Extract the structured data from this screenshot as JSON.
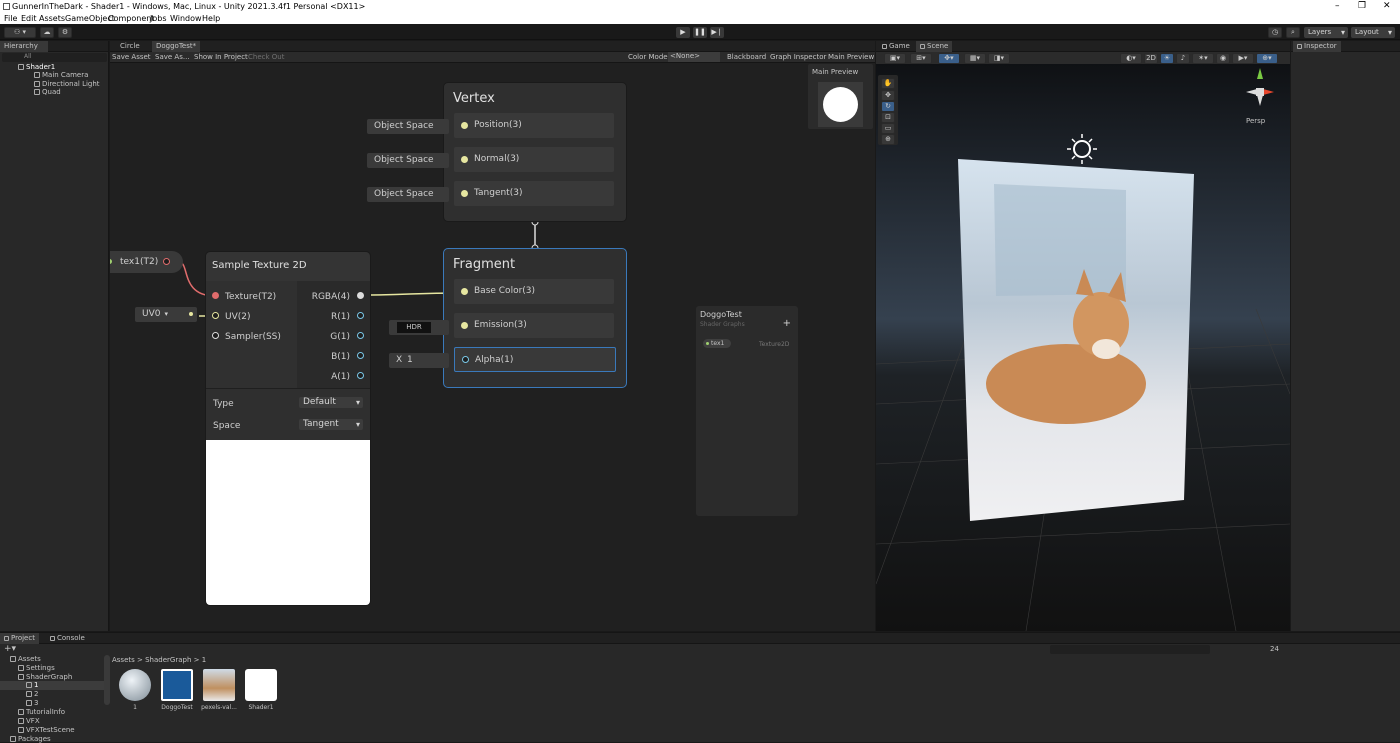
{
  "window": {
    "title": "GunnerInTheDark - Shader1 - Windows, Mac, Linux - Unity 2021.3.4f1 Personal <DX11>"
  },
  "menu": [
    "File",
    "Edit",
    "Assets",
    "GameObject",
    "Component",
    "Jobs",
    "Window",
    "Help"
  ],
  "toolbar": {
    "layers": "Layers",
    "layout": "Layout"
  },
  "hierarchy": {
    "tab": "Hierarchy",
    "search_placeholder": "All",
    "scene": "Shader1",
    "items": [
      "Main Camera",
      "Directional Light",
      "Quad"
    ]
  },
  "graph": {
    "tabs": [
      "Circle",
      "DoggoTest*"
    ],
    "toolbar": {
      "save": "Save Asset",
      "save_as": "Save As...",
      "show": "Show In Project",
      "checkout": "Check Out",
      "color_mode": "Color Mode",
      "color_value": "<None>",
      "blackboard": "Blackboard",
      "inspector": "Graph Inspector",
      "preview": "Main Preview"
    },
    "vertex": {
      "title": "Vertex",
      "slots": [
        "Position(3)",
        "Normal(3)",
        "Tangent(3)"
      ],
      "inputs": [
        "Object Space",
        "Object Space",
        "Object Space"
      ]
    },
    "fragment": {
      "title": "Fragment",
      "slots": [
        "Base Color(3)",
        "Emission(3)",
        "Alpha(1)"
      ],
      "hdr": "HDR",
      "alpha_label": "X",
      "alpha_value": "1"
    },
    "property": {
      "name": "tex1(T2)"
    },
    "sample": {
      "title": "Sample Texture 2D",
      "inputs": [
        "Texture(T2)",
        "UV(2)",
        "Sampler(SS)"
      ],
      "outputs": [
        "RGBA(4)",
        "R(1)",
        "G(1)",
        "B(1)",
        "A(1)"
      ],
      "uv": "UV0",
      "type_label": "Type",
      "type_value": "Default",
      "space_label": "Space",
      "space_value": "Tangent"
    },
    "main_preview": "Main Preview",
    "blackboard": {
      "title": "DoggoTest",
      "subtitle": "Shader Graphs",
      "prop": "tex1",
      "prop_type": "Texture2D"
    }
  },
  "scene": {
    "tabs": [
      "Game",
      "Scene"
    ],
    "persp": "Persp"
  },
  "inspector": {
    "tab": "Inspector"
  },
  "project": {
    "tabs": [
      "Project",
      "Console"
    ],
    "breadcrumb": [
      "Assets",
      "ShaderGraph",
      "1"
    ],
    "count": "24",
    "tree": [
      "Assets",
      "Settings",
      "ShaderGraph",
      "1",
      "2",
      "3",
      "TutorialInfo",
      "VFX",
      "VFXTestScene",
      "Packages"
    ],
    "assets": [
      "1",
      "DoggoTest",
      "pexels-val...",
      "Shader1"
    ]
  },
  "colors": {
    "accent": "#3a79bb",
    "port": "#e6e6a0",
    "texture_port": "#e06c6c",
    "selection": "#2c5d87"
  }
}
